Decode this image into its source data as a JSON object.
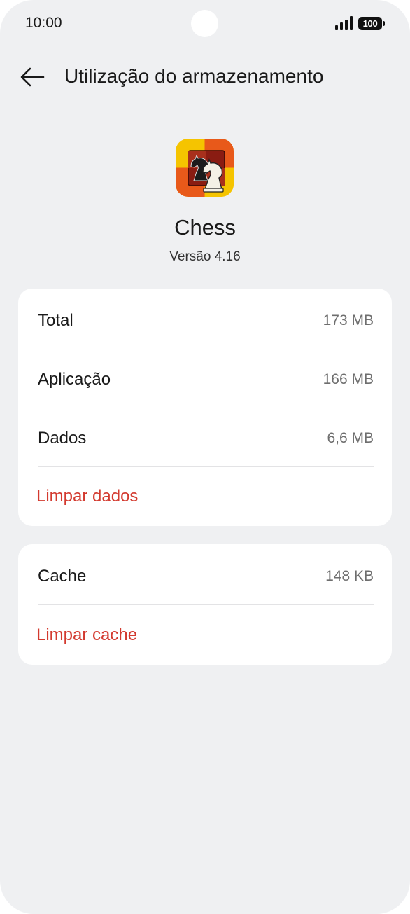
{
  "status_bar": {
    "time": "10:00",
    "battery": "100"
  },
  "header": {
    "title": "Utilização do armazenamento"
  },
  "app": {
    "name": "Chess",
    "version": "Versão 4.16",
    "icon": "chess-knight-icon"
  },
  "storage": {
    "rows": [
      {
        "label": "Total",
        "value": "173 MB"
      },
      {
        "label": "Aplicação",
        "value": "166 MB"
      },
      {
        "label": "Dados",
        "value": "6,6 MB"
      }
    ],
    "clear_label": "Limpar dados"
  },
  "cache": {
    "label": "Cache",
    "value": "148 KB",
    "clear_label": "Limpar cache"
  },
  "colors": {
    "background": "#eff0f2",
    "card": "#ffffff",
    "action_red": "#d33a2f",
    "secondary_text": "#6e6e6e"
  }
}
